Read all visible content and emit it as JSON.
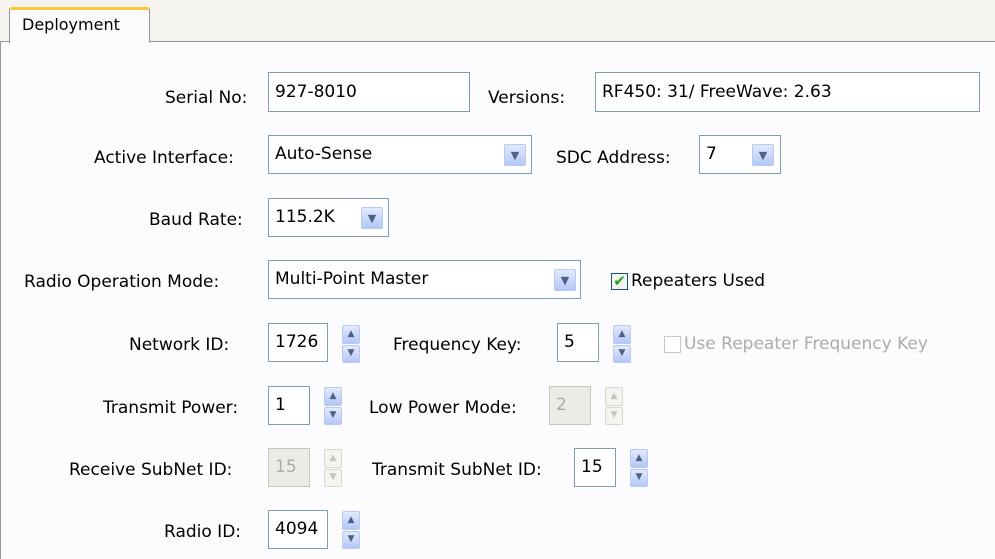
{
  "tabs": [
    {
      "label": "Deployment"
    }
  ],
  "serial": {
    "label": "Serial No:",
    "value": "927-8010"
  },
  "versions": {
    "label": "Versions:",
    "value": "RF450: 31/ FreeWave: 2.63"
  },
  "active_interface": {
    "label": "Active Interface:",
    "value": "Auto-Sense"
  },
  "sdc_address": {
    "label": "SDC Address:",
    "value": "7"
  },
  "baud_rate": {
    "label": "Baud Rate:",
    "value": "115.2K"
  },
  "radio_mode": {
    "label": "Radio Operation Mode:",
    "value": "Multi-Point Master"
  },
  "repeaters_used": {
    "label": "Repeaters Used",
    "checked": true
  },
  "network_id": {
    "label": "Network ID:",
    "value": "1726"
  },
  "frequency_key": {
    "label": "Frequency Key:",
    "value": "5"
  },
  "use_repeater_freq_key": {
    "label": "Use Repeater Frequency Key",
    "checked": false,
    "enabled": false
  },
  "transmit_power": {
    "label": "Transmit Power:",
    "value": "1"
  },
  "low_power_mode": {
    "label": "Low Power Mode:",
    "value": "2",
    "enabled": false
  },
  "receive_subnet_id": {
    "label": "Receive SubNet ID:",
    "value": "15",
    "enabled": false
  },
  "transmit_subnet_id": {
    "label": "Transmit SubNet ID:",
    "value": "15"
  },
  "radio_id": {
    "label": "Radio ID:",
    "value": "4094"
  },
  "icons": {
    "checkmark": "✔",
    "dropdown": "chevron-down-icon",
    "spin_up": "▲",
    "spin_down": "▼"
  },
  "colors": {
    "tab_highlight": "#ffc83c",
    "field_border": "#7f9db9",
    "check_green": "#21a121"
  }
}
